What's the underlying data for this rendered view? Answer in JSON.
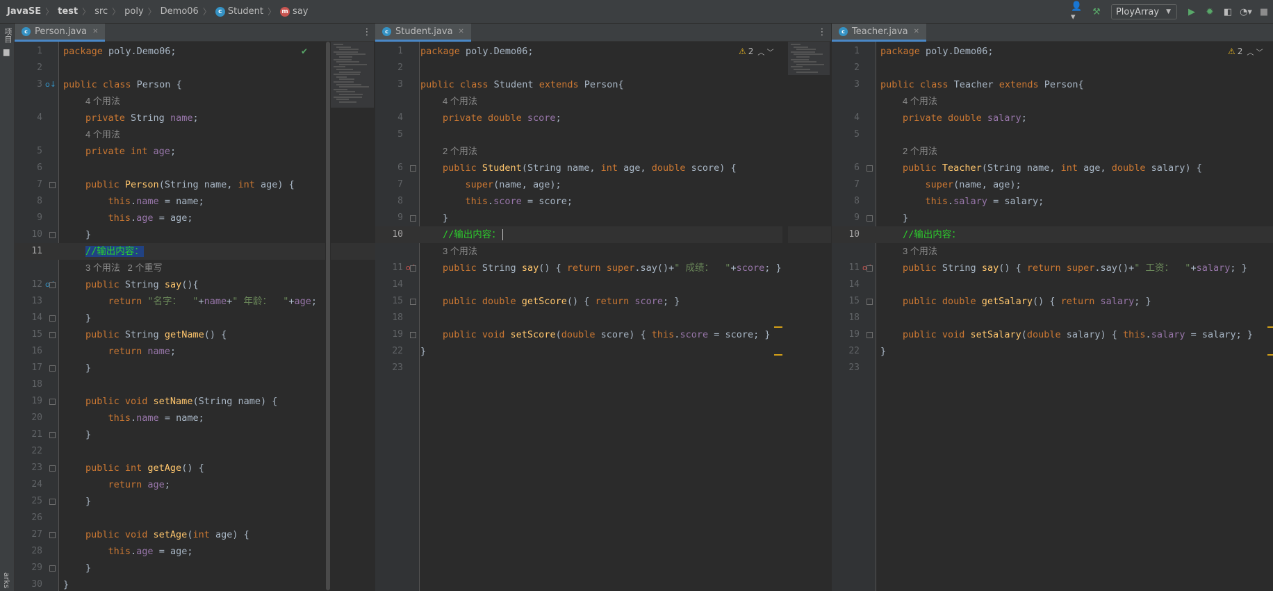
{
  "breadcrumb": [
    "JavaSE",
    "test",
    "src",
    "poly",
    "Demo06",
    "Student",
    "say"
  ],
  "toolbar": {
    "run_config": "PloyArray"
  },
  "left_strip": {
    "top_label": "项目",
    "bottom_label": "arks"
  },
  "editors": [
    {
      "tab": "Person.java",
      "inspection": "",
      "cursor_line": 11,
      "rows": [
        {
          "n": "1",
          "spans": [
            [
              "kw",
              "package "
            ],
            [
              "",
              "poly.Demo06;"
            ]
          ]
        },
        {
          "n": "2",
          "spans": []
        },
        {
          "n": "3",
          "spans": [
            [
              "kw",
              "public class "
            ],
            [
              "",
              "Person {"
            ]
          ],
          "gicon": "o↓"
        },
        {
          "hint": "4 个用法"
        },
        {
          "n": "4",
          "spans": [
            [
              "kw",
              "private "
            ],
            [
              "",
              "String "
            ],
            [
              "fld",
              "name"
            ],
            [
              "",
              ";"
            ]
          ]
        },
        {
          "hint": "4 个用法"
        },
        {
          "n": "5",
          "spans": [
            [
              "kw",
              "private int "
            ],
            [
              "fld",
              "age"
            ],
            [
              "",
              ";"
            ]
          ]
        },
        {
          "n": "6",
          "spans": []
        },
        {
          "n": "7",
          "spans": [
            [
              "kw",
              "public "
            ],
            [
              "fn",
              "Person"
            ],
            [
              "",
              "(String name, "
            ],
            [
              "kw",
              "int "
            ],
            [
              "",
              "age) {"
            ]
          ],
          "fold": true
        },
        {
          "n": "8",
          "spans": [
            [
              "kw",
              "    this"
            ],
            [
              "",
              "."
            ],
            [
              "fld",
              "name"
            ],
            [
              "",
              " = name;"
            ]
          ]
        },
        {
          "n": "9",
          "spans": [
            [
              "kw",
              "    this"
            ],
            [
              "",
              "."
            ],
            [
              "fld",
              "age"
            ],
            [
              "",
              " = age;"
            ]
          ]
        },
        {
          "n": "10",
          "spans": [
            [
              "",
              "}"
            ]
          ],
          "fold": true
        },
        {
          "n": "11",
          "spans": [
            [
              "cm sel",
              "//输出内容："
            ]
          ],
          "cur": true
        },
        {
          "hint": "3 个用法   2 个重写"
        },
        {
          "n": "12",
          "spans": [
            [
              "kw",
              "public "
            ],
            [
              "",
              "String "
            ],
            [
              "fn",
              "say"
            ],
            [
              "",
              "(){"
            ]
          ],
          "fold": true,
          "gicon": "o↓"
        },
        {
          "n": "13",
          "spans": [
            [
              "kw",
              "    return "
            ],
            [
              "str",
              "\"名字：  \""
            ],
            [
              "",
              "+"
            ],
            [
              "fld",
              "name"
            ],
            [
              "",
              "+"
            ],
            [
              "str",
              "\" 年龄：  \""
            ],
            [
              "",
              "+"
            ],
            [
              "fld",
              "age"
            ],
            [
              "",
              ";"
            ]
          ]
        },
        {
          "n": "14",
          "spans": [
            [
              "",
              "}"
            ]
          ],
          "fold": true
        },
        {
          "n": "15",
          "spans": [
            [
              "kw",
              "public "
            ],
            [
              "",
              "String "
            ],
            [
              "fn",
              "getName"
            ],
            [
              "",
              "() {"
            ]
          ],
          "fold": true
        },
        {
          "n": "16",
          "spans": [
            [
              "kw",
              "    return "
            ],
            [
              "fld",
              "name"
            ],
            [
              "",
              ";"
            ]
          ]
        },
        {
          "n": "17",
          "spans": [
            [
              "",
              "}"
            ]
          ],
          "fold": true
        },
        {
          "n": "18",
          "spans": []
        },
        {
          "n": "19",
          "spans": [
            [
              "kw",
              "public void "
            ],
            [
              "fn",
              "setName"
            ],
            [
              "",
              "(String name) {"
            ]
          ],
          "fold": true
        },
        {
          "n": "20",
          "spans": [
            [
              "kw",
              "    this"
            ],
            [
              "",
              "."
            ],
            [
              "fld",
              "name"
            ],
            [
              "",
              " = name;"
            ]
          ]
        },
        {
          "n": "21",
          "spans": [
            [
              "",
              "}"
            ]
          ],
          "fold": true
        },
        {
          "n": "22",
          "spans": []
        },
        {
          "n": "23",
          "spans": [
            [
              "kw",
              "public int "
            ],
            [
              "fn",
              "getAge"
            ],
            [
              "",
              "() {"
            ]
          ],
          "fold": true
        },
        {
          "n": "24",
          "spans": [
            [
              "kw",
              "    return "
            ],
            [
              "fld",
              "age"
            ],
            [
              "",
              ";"
            ]
          ]
        },
        {
          "n": "25",
          "spans": [
            [
              "",
              "}"
            ]
          ],
          "fold": true
        },
        {
          "n": "26",
          "spans": []
        },
        {
          "n": "27",
          "spans": [
            [
              "kw",
              "public void "
            ],
            [
              "fn",
              "setAge"
            ],
            [
              "",
              "("
            ],
            [
              "kw",
              "int "
            ],
            [
              "",
              "age) {"
            ]
          ],
          "fold": true
        },
        {
          "n": "28",
          "spans": [
            [
              "kw",
              "    this"
            ],
            [
              "",
              "."
            ],
            [
              "fld",
              "age"
            ],
            [
              "",
              " = age;"
            ]
          ]
        },
        {
          "n": "29",
          "spans": [
            [
              "",
              "}"
            ]
          ],
          "fold": true
        },
        {
          "n": "30",
          "spans": [
            [
              "",
              "}"
            ]
          ]
        }
      ]
    },
    {
      "tab": "Student.java",
      "inspection": "2",
      "cursor_line": 10,
      "rows": [
        {
          "n": "1",
          "spans": [
            [
              "kw",
              "package "
            ],
            [
              "",
              "poly.Demo06;"
            ]
          ]
        },
        {
          "n": "2",
          "spans": []
        },
        {
          "n": "3",
          "spans": [
            [
              "kw",
              "public class "
            ],
            [
              "",
              "Student "
            ],
            [
              "kw",
              "extends "
            ],
            [
              "",
              "Person{"
            ]
          ]
        },
        {
          "hint": "4 个用法"
        },
        {
          "n": "4",
          "spans": [
            [
              "kw",
              "private double "
            ],
            [
              "fld",
              "score"
            ],
            [
              "",
              ";"
            ]
          ]
        },
        {
          "n": "5",
          "spans": []
        },
        {
          "hint": "2 个用法"
        },
        {
          "n": "6",
          "spans": [
            [
              "kw",
              "public "
            ],
            [
              "fn",
              "Student"
            ],
            [
              "",
              "(String name, "
            ],
            [
              "kw",
              "int "
            ],
            [
              "",
              "age, "
            ],
            [
              "kw",
              "double "
            ],
            [
              "",
              "score) {"
            ]
          ],
          "fold": true
        },
        {
          "n": "7",
          "spans": [
            [
              "kw",
              "    super"
            ],
            [
              "",
              "(name, age);"
            ]
          ]
        },
        {
          "n": "8",
          "spans": [
            [
              "kw",
              "    this"
            ],
            [
              "",
              "."
            ],
            [
              "fld",
              "score"
            ],
            [
              "",
              " = score;"
            ]
          ]
        },
        {
          "n": "9",
          "spans": [
            [
              "",
              "}"
            ]
          ],
          "fold": true
        },
        {
          "n": "10",
          "spans": [
            [
              "cm",
              "//输出内容："
            ]
          ],
          "cur": true,
          "caret": true
        },
        {
          "hint": "3 个用法"
        },
        {
          "n": "11",
          "spans": [
            [
              "kw",
              "public "
            ],
            [
              "",
              "String "
            ],
            [
              "fn",
              "say"
            ],
            [
              "",
              "() { "
            ],
            [
              "kw",
              "return super"
            ],
            [
              "",
              ".say()+"
            ],
            [
              "str",
              "\" 成绩：  \""
            ],
            [
              "",
              "+"
            ],
            [
              "fld",
              "score"
            ],
            [
              "",
              "; }"
            ]
          ],
          "fold": true,
          "gicon": "o↑"
        },
        {
          "n": "14",
          "spans": []
        },
        {
          "n": "15",
          "spans": [
            [
              "kw",
              "public double "
            ],
            [
              "fn",
              "getScore"
            ],
            [
              "",
              "() { "
            ],
            [
              "kw",
              "return "
            ],
            [
              "fld",
              "score"
            ],
            [
              "",
              "; }"
            ]
          ],
          "fold": true
        },
        {
          "n": "18",
          "spans": []
        },
        {
          "n": "19",
          "spans": [
            [
              "kw",
              "public void "
            ],
            [
              "fn",
              "setScore"
            ],
            [
              "",
              "("
            ],
            [
              "kw",
              "double "
            ],
            [
              "",
              "score) { "
            ],
            [
              "kw",
              "this"
            ],
            [
              "",
              "."
            ],
            [
              "fld",
              "score"
            ],
            [
              "",
              " = score; }"
            ]
          ],
          "fold": true
        },
        {
          "n": "22",
          "spans": [
            [
              "",
              "}"
            ]
          ]
        },
        {
          "n": "23",
          "spans": []
        }
      ]
    },
    {
      "tab": "Teacher.java",
      "inspection": "2",
      "cursor_line": 10,
      "rows": [
        {
          "n": "1",
          "spans": [
            [
              "kw",
              "package "
            ],
            [
              "",
              "poly.Demo06;"
            ]
          ]
        },
        {
          "n": "2",
          "spans": []
        },
        {
          "n": "3",
          "spans": [
            [
              "kw",
              "public class "
            ],
            [
              "",
              "Teacher "
            ],
            [
              "kw",
              "extends "
            ],
            [
              "",
              "Person{"
            ]
          ]
        },
        {
          "hint": "4 个用法"
        },
        {
          "n": "4",
          "spans": [
            [
              "kw",
              "private double "
            ],
            [
              "fld",
              "salary"
            ],
            [
              "",
              ";"
            ]
          ]
        },
        {
          "n": "5",
          "spans": []
        },
        {
          "hint": "2 个用法"
        },
        {
          "n": "6",
          "spans": [
            [
              "kw",
              "public "
            ],
            [
              "fn",
              "Teacher"
            ],
            [
              "",
              "(String name, "
            ],
            [
              "kw",
              "int "
            ],
            [
              "",
              "age, "
            ],
            [
              "kw",
              "double "
            ],
            [
              "",
              "salary) {"
            ]
          ],
          "fold": true
        },
        {
          "n": "7",
          "spans": [
            [
              "kw",
              "    super"
            ],
            [
              "",
              "(name, age);"
            ]
          ]
        },
        {
          "n": "8",
          "spans": [
            [
              "kw",
              "    this"
            ],
            [
              "",
              "."
            ],
            [
              "fld",
              "salary"
            ],
            [
              "",
              " = salary;"
            ]
          ]
        },
        {
          "n": "9",
          "spans": [
            [
              "",
              "}"
            ]
          ],
          "fold": true
        },
        {
          "n": "10",
          "spans": [
            [
              "cm",
              "//输出内容："
            ]
          ],
          "cur": true
        },
        {
          "hint": "3 个用法"
        },
        {
          "n": "11",
          "spans": [
            [
              "kw",
              "public "
            ],
            [
              "",
              "String "
            ],
            [
              "fn",
              "say"
            ],
            [
              "",
              "() { "
            ],
            [
              "kw",
              "return super"
            ],
            [
              "",
              ".say()+"
            ],
            [
              "str",
              "\" 工资：  \""
            ],
            [
              "",
              "+"
            ],
            [
              "fld",
              "salary"
            ],
            [
              "",
              "; }"
            ]
          ],
          "fold": true,
          "gicon": "o↑"
        },
        {
          "n": "14",
          "spans": []
        },
        {
          "n": "15",
          "spans": [
            [
              "kw",
              "public double "
            ],
            [
              "fn",
              "getSalary"
            ],
            [
              "",
              "() { "
            ],
            [
              "kw",
              "return "
            ],
            [
              "fld",
              "salary"
            ],
            [
              "",
              "; }"
            ]
          ],
          "fold": true
        },
        {
          "n": "18",
          "spans": []
        },
        {
          "n": "19",
          "spans": [
            [
              "kw",
              "public void "
            ],
            [
              "fn",
              "setSalary"
            ],
            [
              "",
              "("
            ],
            [
              "kw",
              "double "
            ],
            [
              "",
              "salary) { "
            ],
            [
              "kw",
              "this"
            ],
            [
              "",
              "."
            ],
            [
              "fld",
              "salary"
            ],
            [
              "",
              " = salary; }"
            ]
          ],
          "fold": true
        },
        {
          "n": "22",
          "spans": [
            [
              "",
              "}"
            ]
          ]
        },
        {
          "n": "23",
          "spans": []
        }
      ]
    }
  ]
}
